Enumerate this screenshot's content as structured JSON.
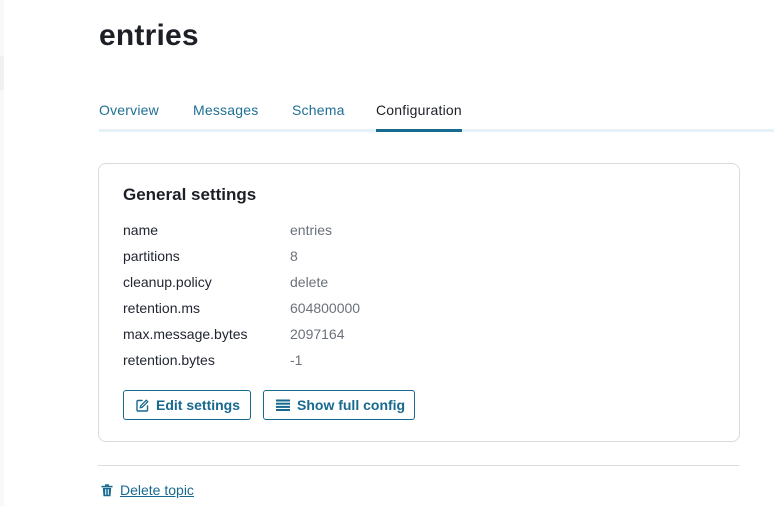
{
  "page": {
    "title": "entries"
  },
  "tabs": [
    {
      "label": "Overview",
      "active": false
    },
    {
      "label": "Messages",
      "active": false
    },
    {
      "label": "Schema",
      "active": false
    },
    {
      "label": "Configuration",
      "active": true
    }
  ],
  "general": {
    "title": "General settings",
    "rows": [
      {
        "key": "name",
        "value": "entries"
      },
      {
        "key": "partitions",
        "value": "8"
      },
      {
        "key": "cleanup.policy",
        "value": "delete"
      },
      {
        "key": "retention.ms",
        "value": "604800000"
      },
      {
        "key": "max.message.bytes",
        "value": "2097164"
      },
      {
        "key": "retention.bytes",
        "value": "-1"
      }
    ],
    "edit_label": "Edit settings",
    "edit_icon": "edit-icon",
    "full_config_label": "Show full config",
    "full_config_icon": "list-icon"
  },
  "delete": {
    "label": "Delete topic",
    "icon": "trash-icon"
  },
  "colors": {
    "accent": "#17698f",
    "tab_link": "#1f6f95",
    "muted_text": "#6b717b",
    "border": "#d8dce1"
  }
}
